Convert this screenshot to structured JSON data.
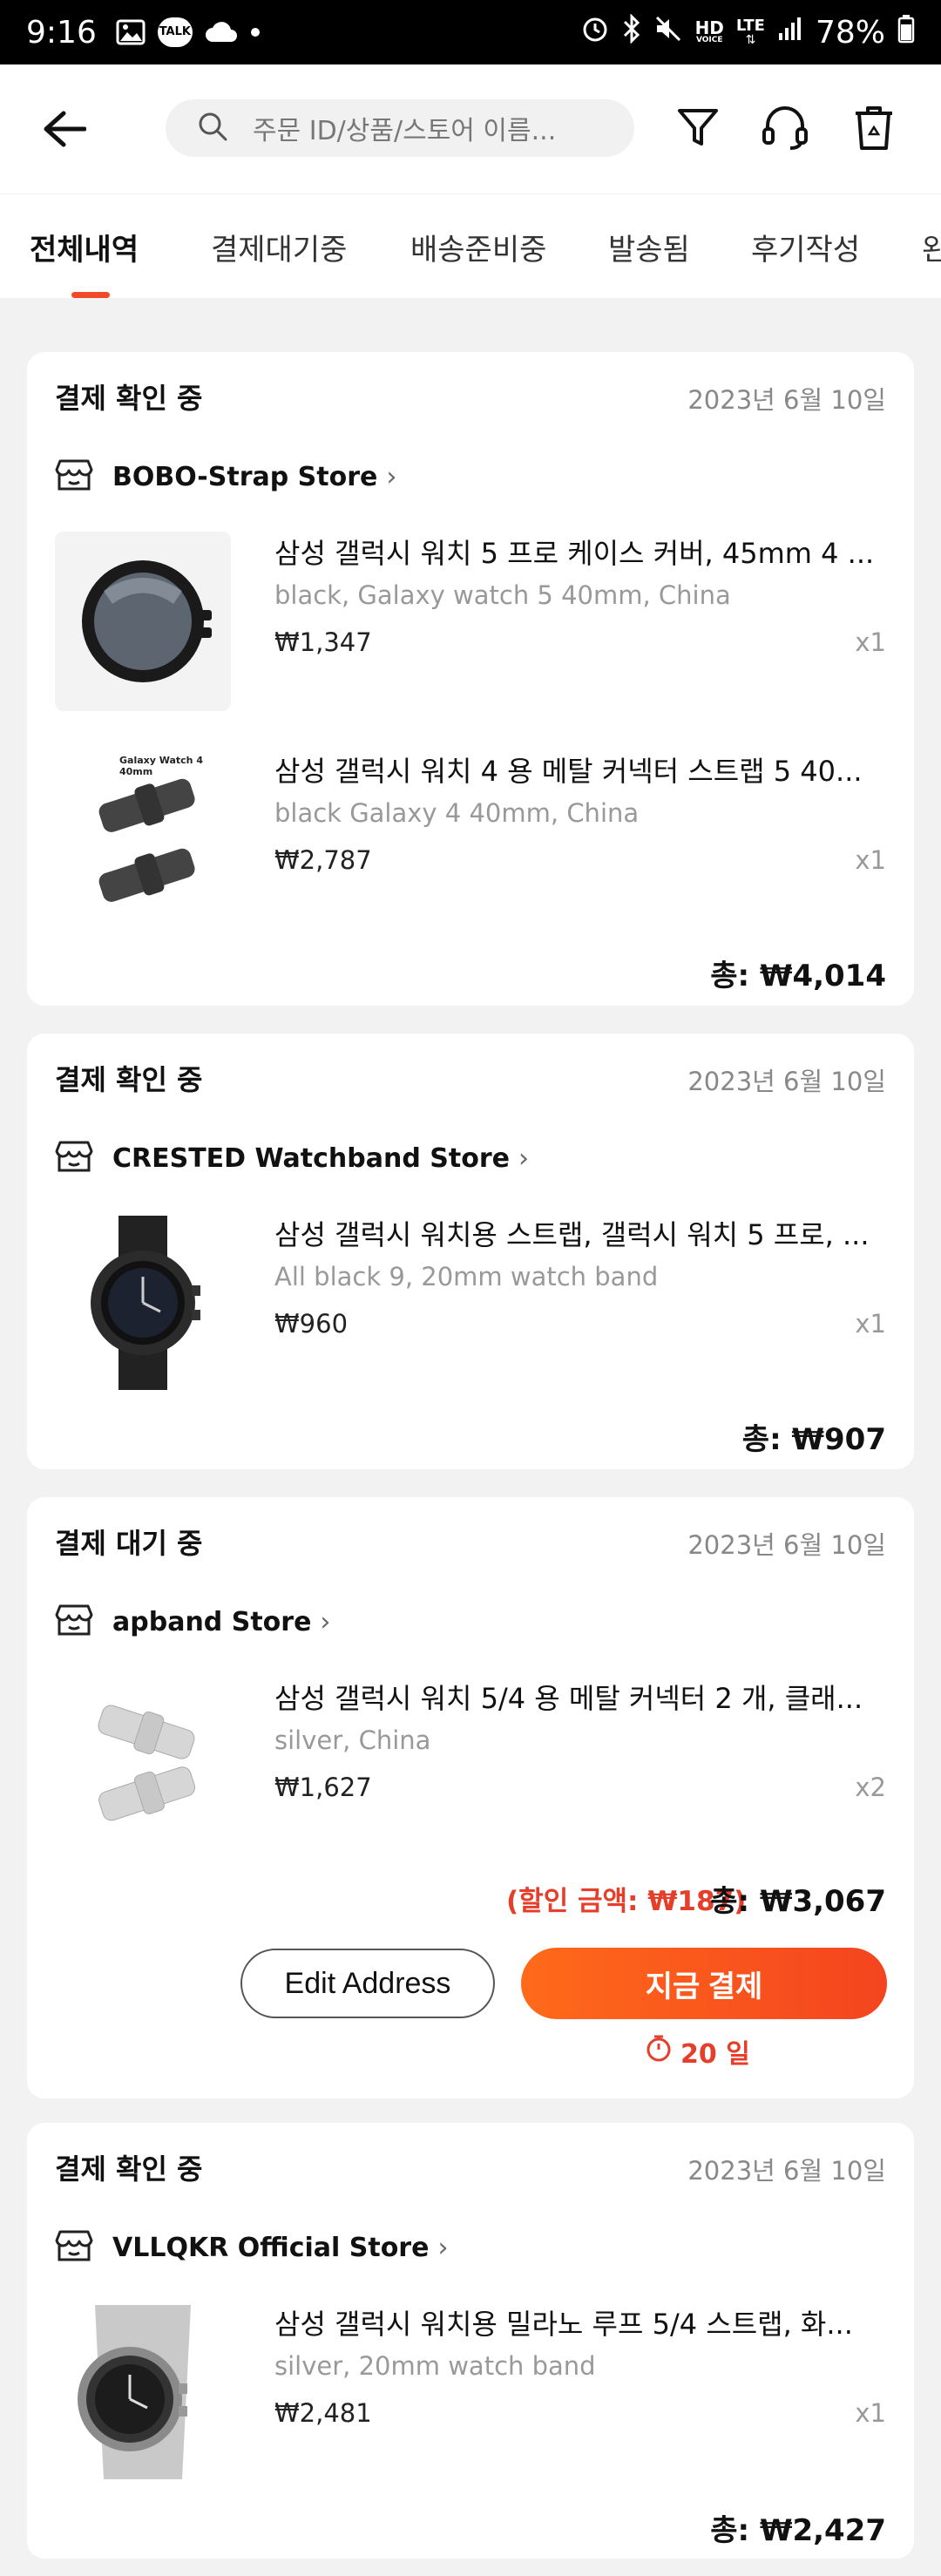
{
  "status_bar": {
    "time": "9:16",
    "talk_label": "TALK",
    "hd_label": "HD",
    "voice_label": "VOICE",
    "lte_label": "LTE",
    "battery": "78%"
  },
  "header": {
    "search_placeholder": "주문 ID/상품/스토어 이름..."
  },
  "tabs": [
    {
      "label": "전체내역",
      "active": true
    },
    {
      "label": "결제대기중"
    },
    {
      "label": "배송준비중"
    },
    {
      "label": "발송됨"
    },
    {
      "label": "후기작성"
    },
    {
      "label": "완"
    }
  ],
  "orders": [
    {
      "status": "결제 확인 중",
      "date": "2023년 6월 10일",
      "store": "BOBO-Strap Store",
      "items": [
        {
          "title": "삼성 갤럭시 워치 5 프로 케이스 커버, 45mm 4 ...",
          "spec": "black, Galaxy watch 5 40mm, China",
          "price": "₩1,347",
          "qty": "x1"
        },
        {
          "title": "삼성 갤럭시 워치 4 용 메탈 커넥터 스트랩 5 40...",
          "spec": "black Galaxy 4 40mm, China",
          "price": "₩2,787",
          "qty": "x1",
          "thumb_caption": "Galaxy Watch 4 40mm"
        }
      ],
      "total": "총: ₩4,014"
    },
    {
      "status": "결제 확인 중",
      "date": "2023년 6월 10일",
      "store": "CRESTED Watchband Store",
      "items": [
        {
          "title": "삼성 갤럭시 워치용 스트랩, 갤럭시 워치 5 프로, ...",
          "spec": "All black 9, 20mm watch band",
          "price": "₩960",
          "qty": "x1"
        }
      ],
      "total": "총: ₩907"
    },
    {
      "status": "결제 대기 중",
      "date": "2023년 6월 10일",
      "store": "apband Store",
      "items": [
        {
          "title": "삼성 갤럭시 워치 5/4 용 메탈 커넥터 2 개, 클래...",
          "spec": "silver, China",
          "price": "₩1,627",
          "qty": "x2"
        }
      ],
      "discount": "(할인 금액: ₩187)",
      "total": "총: ₩3,067",
      "edit_address": "Edit Address",
      "pay_now": "지금 결제",
      "countdown": "20 일"
    },
    {
      "status": "결제 확인 중",
      "date": "2023년 6월 10일",
      "store": "VLLQKR Official Store",
      "items": [
        {
          "title": "삼성 갤럭시 워치용 밀라노 루프 5/4 스트랩, 화...",
          "spec": "silver, 20mm watch band",
          "price": "₩2,481",
          "qty": "x1"
        }
      ],
      "total": "총: ₩2,427"
    }
  ],
  "colors": {
    "accent": "#f04a2b",
    "pay_gradient_start": "#ff6a1a",
    "pay_gradient_end": "#f4441f"
  }
}
